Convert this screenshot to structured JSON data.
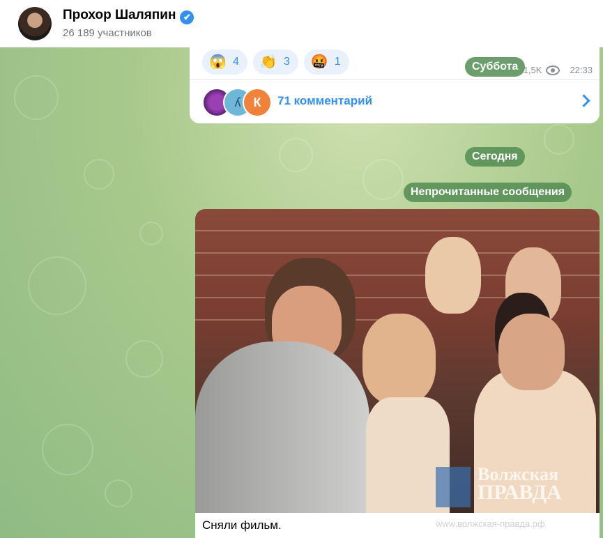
{
  "header": {
    "channel_name": "Прохор Шаляпин",
    "members": "26 189 участников",
    "verified_glyph": "✔"
  },
  "previous_post": {
    "reactions": [
      {
        "emoji": "😱",
        "icon": "scream-emoji-icon",
        "count": "4"
      },
      {
        "emoji": "👏",
        "icon": "clap-emoji-icon",
        "count": "3"
      },
      {
        "emoji": "🤬",
        "icon": "cursing-emoji-icon",
        "count": "1"
      }
    ],
    "date_pill": "Суббота",
    "views": "1,5K",
    "time": "22:33",
    "comments": {
      "label": "71 комментарий",
      "avatar_letters": [
        "",
        "ʎ",
        "К"
      ]
    }
  },
  "separators": {
    "today": "Сегодня",
    "unread": "Непрочитанные сообщения"
  },
  "photo_post": {
    "caption": "Сняли фильм.",
    "watermark_line1": "Волжская",
    "watermark_line2": "ПРАВДА",
    "watermark_url": "www.волжская-правда.рф"
  },
  "colors": {
    "accent": "#3390ec",
    "pill": "#528c52",
    "chat_bg": "#a8c98c"
  }
}
